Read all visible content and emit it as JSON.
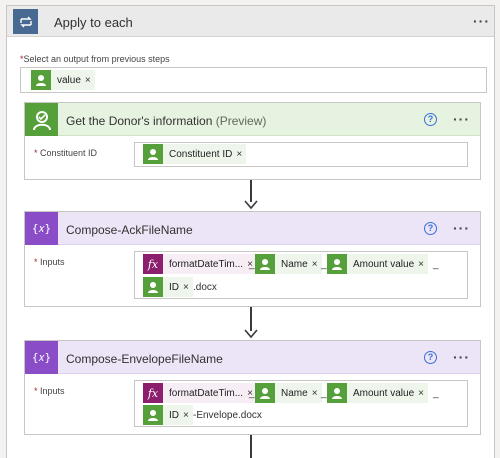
{
  "loop": {
    "title": "Apply to each",
    "select_label": "Select an output from previous steps",
    "select_token": "value",
    "more": "···"
  },
  "cards": {
    "donor": {
      "title": "Get the Donor's information",
      "suffix": "(Preview)",
      "help": "?",
      "more": "···",
      "field_label": "Constituent ID",
      "token": "Constituent ID"
    },
    "ack": {
      "title": "Compose-AckFileName",
      "help": "?",
      "more": "···",
      "field_label": "Inputs",
      "icon_glyph": "{𝑥}",
      "fx_token": "formatDateTim...",
      "name_token": "Name",
      "amount_token": "Amount value",
      "id_token": "ID",
      "sep": "_",
      "tail": ".docx"
    },
    "env": {
      "title": "Compose-EnvelopeFileName",
      "help": "?",
      "more": "···",
      "field_label": "Inputs",
      "icon_glyph": "{𝑥}",
      "fx_token": "formatDateTim...",
      "name_token": "Name",
      "amount_token": "Amount value",
      "id_token": "ID",
      "sep": "_",
      "tail": "-Envelope.docx"
    }
  },
  "common": {
    "remove": "×",
    "required_mark": "*",
    "fx_glyph": "fx"
  },
  "colors": {
    "loop_icon": "#486991",
    "connector_green": "#55a03a",
    "compose_purple": "#8a4cc7",
    "expression_magenta": "#8c1e6e",
    "help_blue": "#3a6fd8"
  }
}
